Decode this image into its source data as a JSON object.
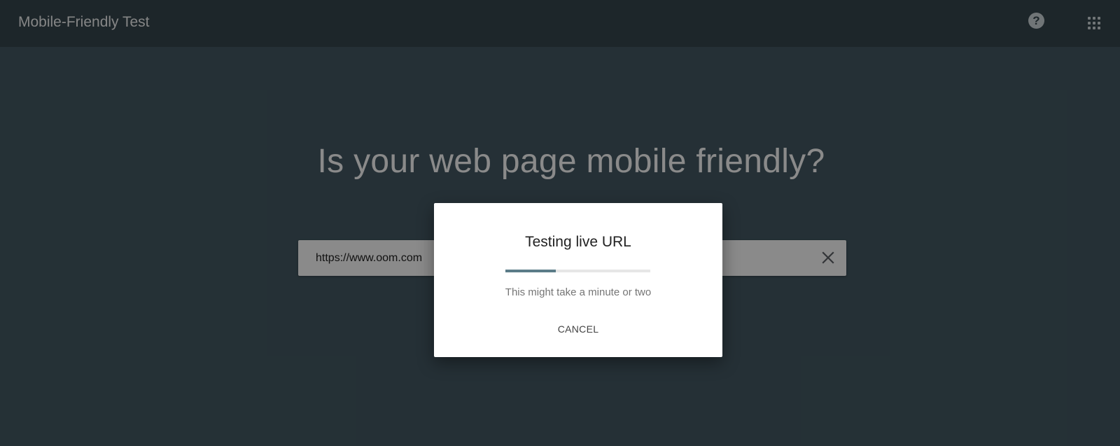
{
  "header": {
    "title": "Mobile-Friendly Test",
    "help_glyph": "?",
    "help_icon": "help-circle-icon",
    "apps_icon": "apps-grid-icon"
  },
  "main": {
    "headline": "Is your web page mobile friendly?",
    "url_value": "https://www.oom.com",
    "clear_icon": "close-icon"
  },
  "dialog": {
    "title": "Testing live URL",
    "progress_fraction": 0.35,
    "message": "This might take a minute or two",
    "cancel_label": "CANCEL"
  },
  "colors": {
    "header_bg": "#37474f",
    "page_bg": "#455a64",
    "progress_fill": "#5b7c88",
    "progress_track": "#e6e6e6"
  }
}
